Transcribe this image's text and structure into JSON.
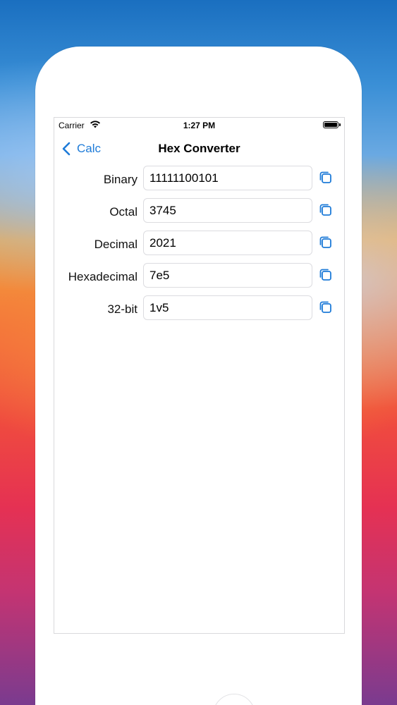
{
  "status_bar": {
    "carrier": "Carrier",
    "time": "1:27 PM",
    "icons": [
      "wifi-icon",
      "battery-icon"
    ]
  },
  "nav": {
    "back_label": "Calc",
    "title": "Hex Converter"
  },
  "rows": [
    {
      "label": "Binary",
      "value": "11111100101"
    },
    {
      "label": "Octal",
      "value": "3745"
    },
    {
      "label": "Decimal",
      "value": "2021"
    },
    {
      "label": "Hexadecimal",
      "value": "7e5"
    },
    {
      "label": "32-bit",
      "value": "1v5"
    }
  ],
  "colors": {
    "accent": "#1e7bd8",
    "input_border": "#dcdce0"
  }
}
